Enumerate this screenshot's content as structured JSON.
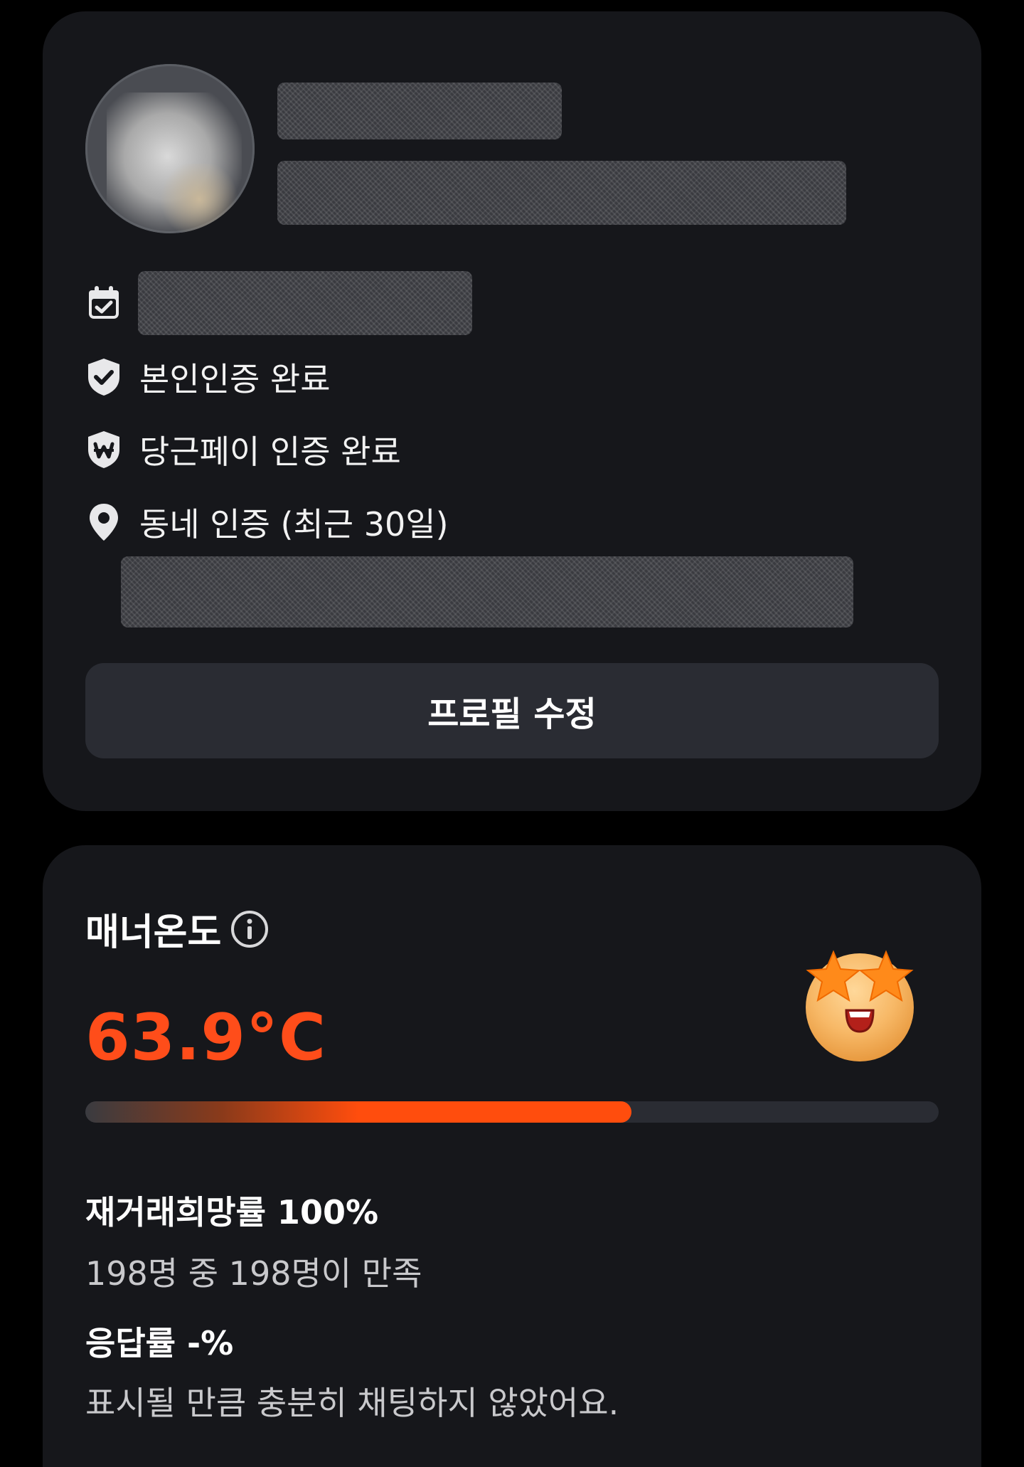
{
  "profile": {
    "verifications": [
      {
        "icon": "shield-check-icon",
        "label": "본인인증 완료"
      },
      {
        "icon": "won-shield-icon",
        "label": "당근페이 인증 완료"
      },
      {
        "icon": "location-pin-icon",
        "label": "동네 인증 (최근 30일)"
      }
    ],
    "edit_button_label": "프로필 수정"
  },
  "manner": {
    "title": "매너온도",
    "temperature": "63.9°C",
    "temperature_value": 63.9,
    "progress_fraction": 0.64,
    "accent_color": "#ff4d1a",
    "emoji_icon": "star-eyes-face-icon",
    "rehire_label": "재거래희망률 100%",
    "rehire_detail": "198명 중 198명이 만족",
    "response_label": "응답률 -%",
    "response_detail": "표시될 만큼 충분히 채팅하지 않았어요."
  }
}
